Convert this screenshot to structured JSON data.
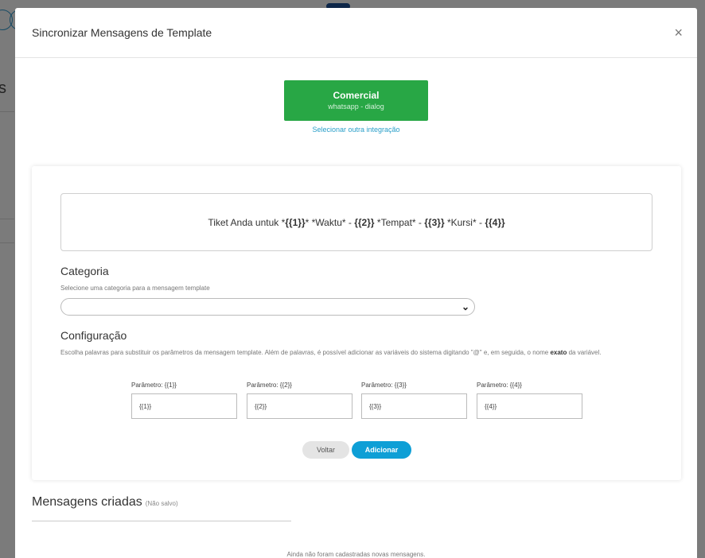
{
  "modal": {
    "title": "Sincronizar Mensagens de Template",
    "close_glyph": "×"
  },
  "integration": {
    "name": "Comercial",
    "subtitle": "whatsapp - dialog",
    "change_link": "Selecionar outra integração"
  },
  "template_preview": {
    "segments": [
      {
        "text": "Tiket Anda untuk *",
        "bold": false
      },
      {
        "text": "{{1}}",
        "bold": true
      },
      {
        "text": "* *Waktu* - ",
        "bold": false
      },
      {
        "text": "{{2}}",
        "bold": true
      },
      {
        "text": " *Tempat* - ",
        "bold": false
      },
      {
        "text": "{{3}}",
        "bold": true
      },
      {
        "text": " *Kursi* - ",
        "bold": false
      },
      {
        "text": "{{4}}",
        "bold": true
      }
    ]
  },
  "category": {
    "title": "Categoria",
    "description": "Selecione uma categoria para a mensagem template",
    "selected_value": ""
  },
  "configuration": {
    "title": "Configuração",
    "description_before": "Escolha palavras para substituir os parâmetros da mensagem template. Além de palavras, é possível adicionar as variáveis do sistema digitando \"@\" e, em seguida, o nome ",
    "description_bold": "exato",
    "description_after": " da variável.",
    "params": [
      {
        "label": "Parâmetro: {{1}}",
        "value": "{{1}}"
      },
      {
        "label": "Parâmetro: {{2}}",
        "value": "{{2}}"
      },
      {
        "label": "Parâmetro: {{3}}",
        "value": "{{3}}"
      },
      {
        "label": "Parâmetro: {{4}}",
        "value": "{{4}}"
      }
    ]
  },
  "buttons": {
    "back": "Voltar",
    "add": "Adicionar"
  },
  "created": {
    "title": "Mensagens criadas",
    "subtitle": "(Não salvo)",
    "empty": "Ainda não foram cadastradas novas mensagens."
  },
  "colors": {
    "integration_green": "#28a745",
    "primary_blue": "#0e9fd6",
    "link_blue": "#2a9fc9"
  },
  "icons": {
    "close": "close-icon",
    "select_chevron": "chevron-down-icon"
  }
}
